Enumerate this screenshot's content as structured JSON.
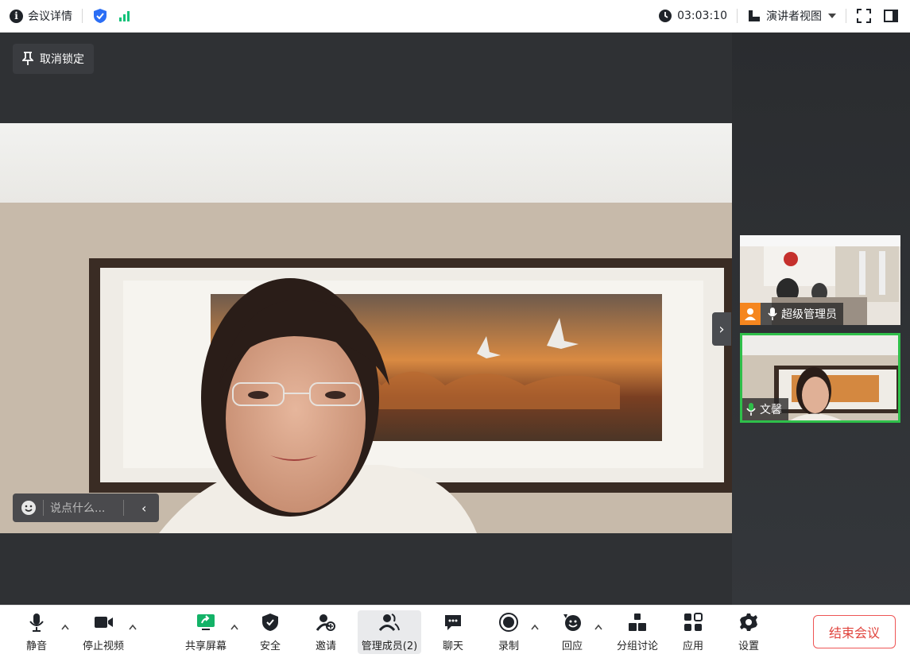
{
  "topbar": {
    "meeting_info": "会议详情",
    "timer": "03:03:10",
    "view_mode": "演讲者视图"
  },
  "stage": {
    "unlock": "取消锁定",
    "chat_placeholder": "说点什么..."
  },
  "participants": [
    {
      "name": "超级管理员",
      "role_color": "#f5861f"
    },
    {
      "name": "文馨",
      "active": true,
      "speaker_border": "#2fbf4a"
    }
  ],
  "toolbar": {
    "mute": "静音",
    "stop_video": "停止视频",
    "share_screen": "共享屏幕",
    "security": "安全",
    "invite": "邀请",
    "manage_members": "管理成员(2)",
    "chat": "聊天",
    "record": "录制",
    "reaction": "回应",
    "breakout": "分组讨论",
    "apps": "应用",
    "settings": "设置",
    "end_meeting": "结束会议"
  },
  "colors": {
    "accent_green": "#13c27a",
    "shield_blue": "#2b6ef5",
    "end_red": "#e0433c"
  }
}
